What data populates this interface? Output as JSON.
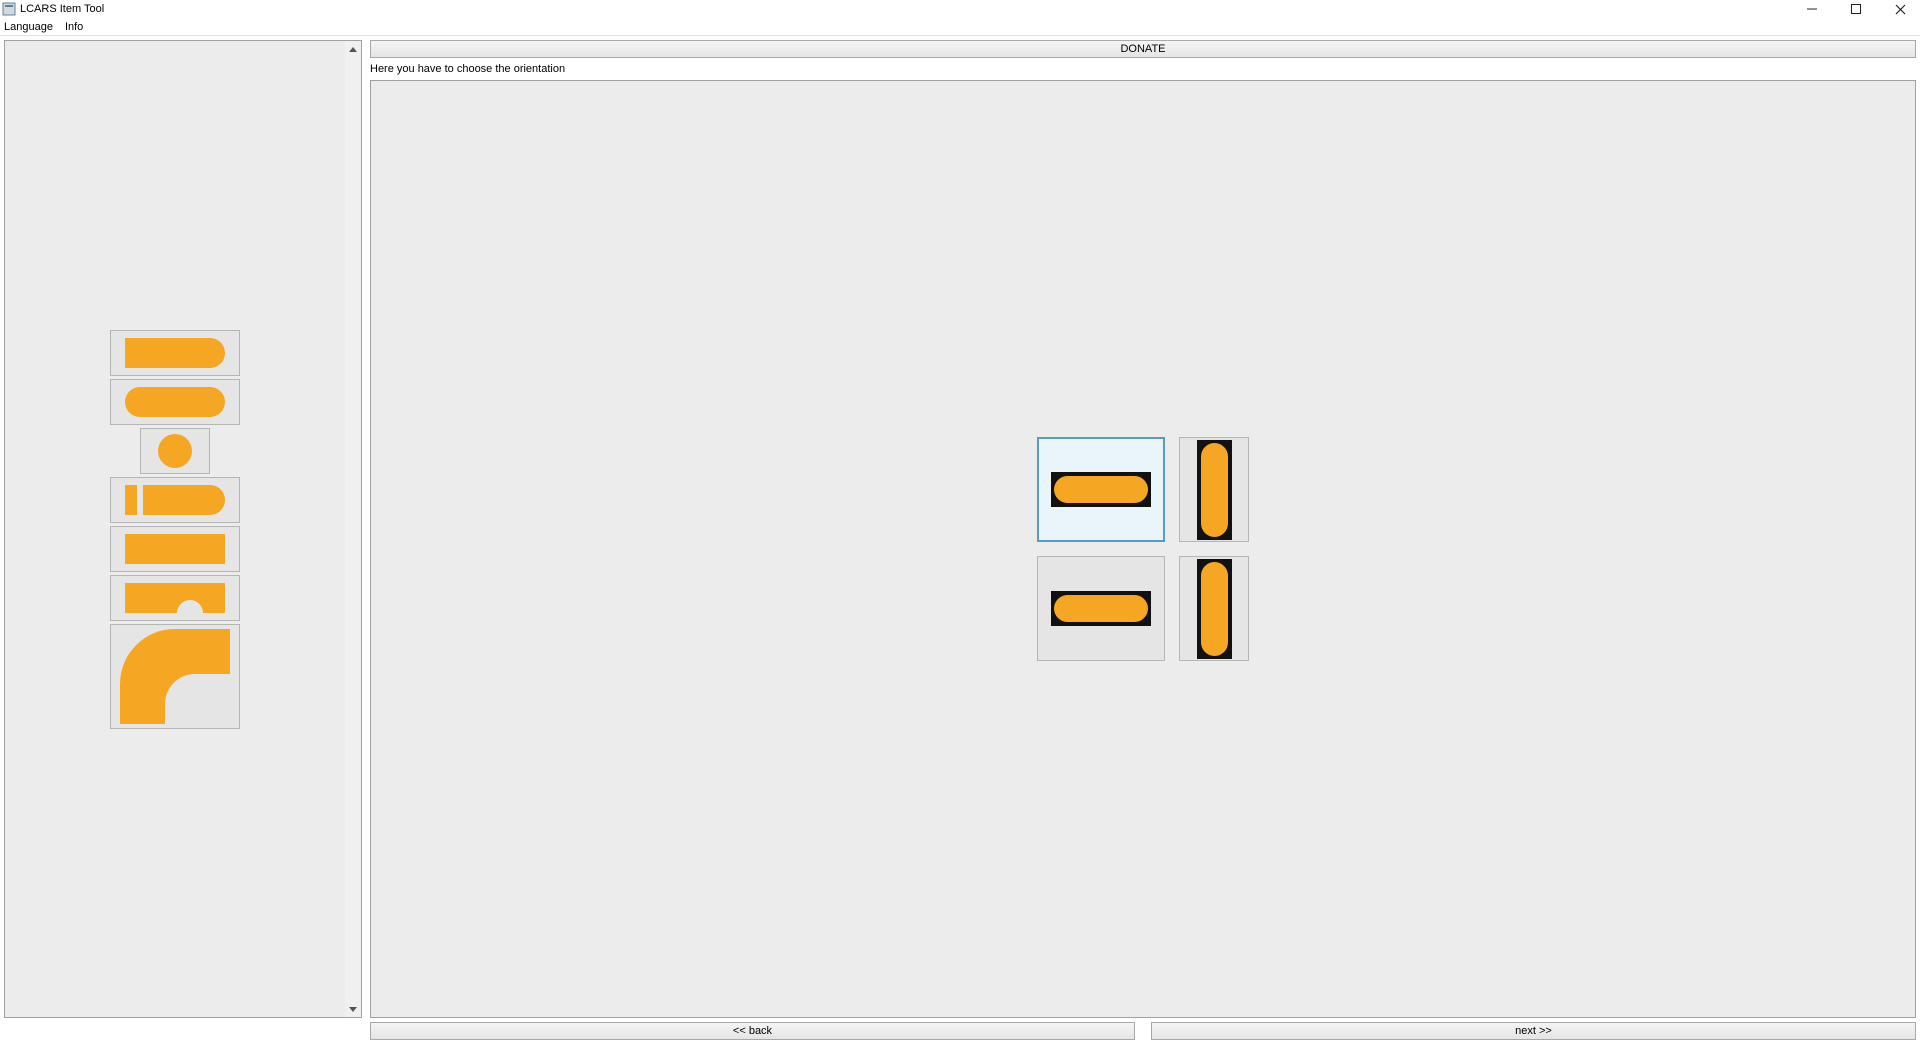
{
  "window": {
    "title": "LCARS Item Tool"
  },
  "menu": {
    "language": "Language",
    "info": "Info"
  },
  "donate": "DONATE",
  "instruction": "Here you have to choose the orientation",
  "footer": {
    "back": "<< back",
    "next": "next >>"
  },
  "colors": {
    "accent": "#f5a623"
  }
}
